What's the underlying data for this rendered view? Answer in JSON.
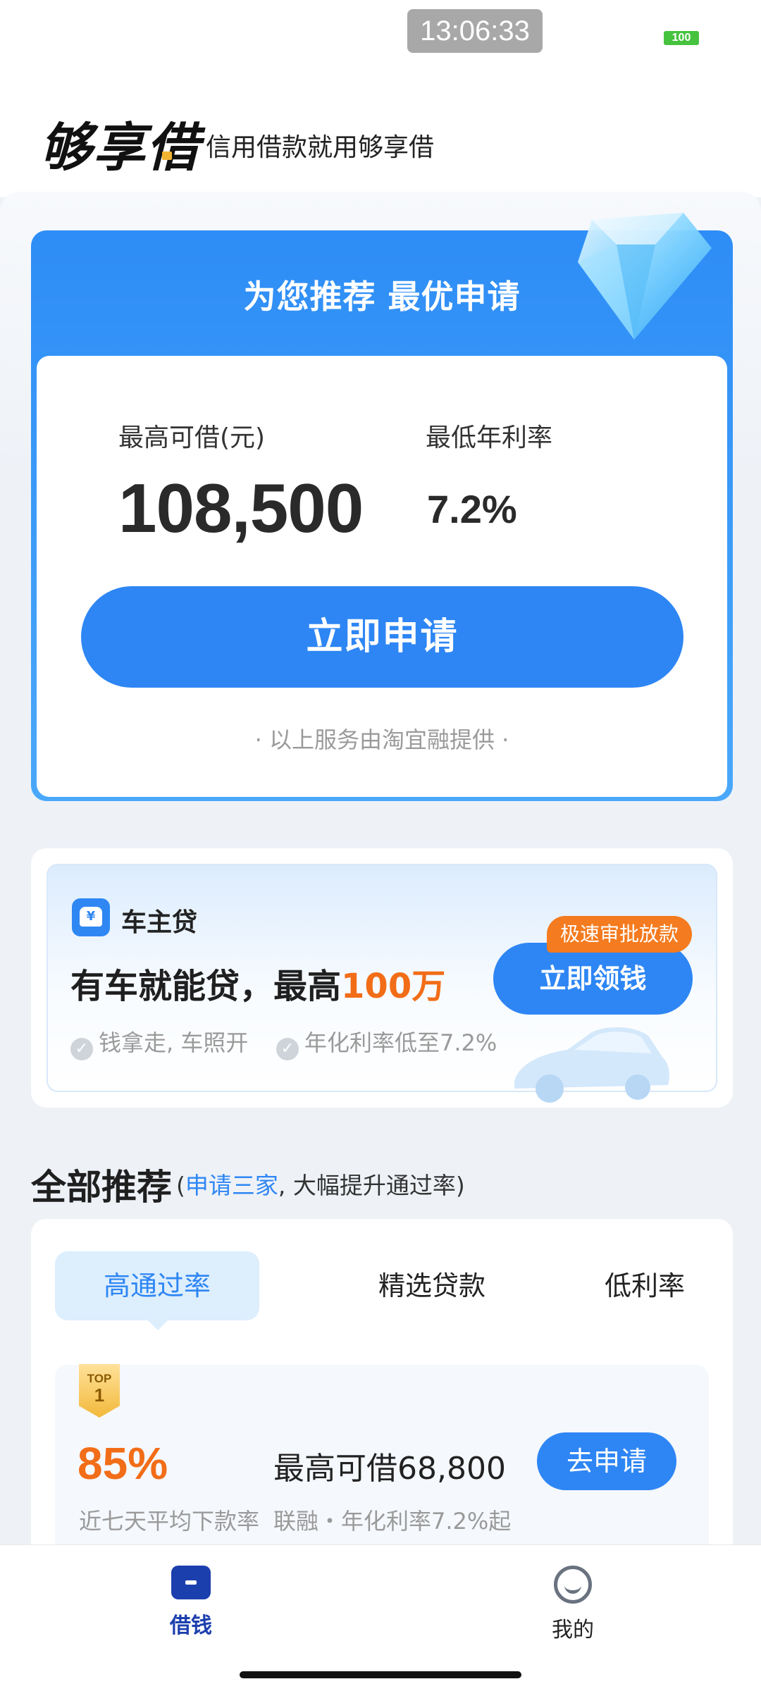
{
  "status_bar": {
    "time": "13:06:33",
    "battery": "100"
  },
  "header": {
    "brand": "够享借",
    "slogan": "信用借款就用够享借"
  },
  "main_card": {
    "title": "为您推荐 最优申请",
    "max_label": "最高可借(元)",
    "max_amount": "108,500",
    "rate_label": "最低年利率",
    "rate_value": "7.2%",
    "apply_button": "立即申请",
    "provider_note": "· 以上服务由淘宜融提供 ·"
  },
  "car_loan": {
    "name": "车主贷",
    "logo_symbol": "¥",
    "headline_prefix": "有车就能贷，最高",
    "headline_highlight": "100万",
    "feature_1": "钱拿走, 车照开",
    "feature_2": "年化利率低至7.2%",
    "badge": "极速审批放款",
    "button": "立即领钱"
  },
  "recommend": {
    "title": "全部推荐",
    "subtitle_open": "(",
    "subtitle_highlight": "申请三家",
    "subtitle_rest": ", 大幅提升通过率)",
    "tabs": [
      {
        "label": "高通过率",
        "active": true
      },
      {
        "label": "精选贷款",
        "active": false
      },
      {
        "label": "低利率",
        "active": false
      }
    ],
    "items": [
      {
        "badge_top": "TOP",
        "badge_rank": "1",
        "pass_rate": "85%",
        "pass_rate_desc": "近七天平均下款率",
        "max_amount": "最高可借68,800",
        "desc": "联融・年化利率7.2%起",
        "button": "去申请"
      }
    ]
  },
  "bottom_nav": {
    "items": [
      {
        "label": "借钱",
        "icon": "wallet-icon",
        "active": true
      },
      {
        "label": "我的",
        "icon": "smiley-icon",
        "active": false
      }
    ]
  },
  "colors": {
    "primary": "#2e86f4",
    "accent_orange": "#f26d17",
    "nav_active": "#1c3fae"
  }
}
